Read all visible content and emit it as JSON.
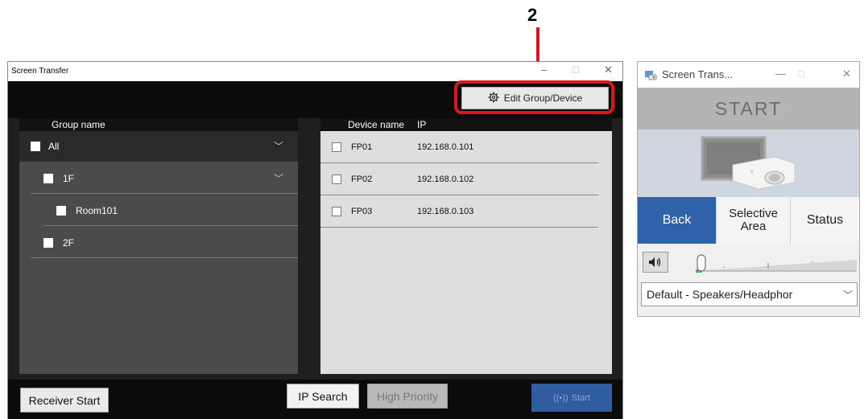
{
  "callout": {
    "number": "2"
  },
  "main_window": {
    "title": "Screen Transfer",
    "controls": {
      "minimize": "–",
      "maximize": "□",
      "close": "✕"
    },
    "edit_button": {
      "label": "Edit Group/Device",
      "icon": "gear-icon"
    },
    "group_panel": {
      "header": "Group name",
      "rows": [
        {
          "label": "All",
          "checked": false,
          "expandable": true
        },
        {
          "label": "1F",
          "checked": false,
          "expandable": true
        },
        {
          "label": "Room101",
          "checked": false,
          "expandable": false
        },
        {
          "label": "2F",
          "checked": false,
          "expandable": false
        }
      ]
    },
    "device_panel": {
      "header_name": "Device name",
      "header_ip": "IP",
      "rows": [
        {
          "name": "FP01",
          "ip": "192.168.0.101"
        },
        {
          "name": "FP02",
          "ip": "192.168.0.102"
        },
        {
          "name": "FP03",
          "ip": "192.168.0.103"
        }
      ]
    },
    "buttons": {
      "receiver_start": "Receiver Start",
      "ip_search": "IP Search",
      "high_priority": "High Priority",
      "start": "Start"
    }
  },
  "mini_window": {
    "title": "Screen Trans...",
    "controls": {
      "minimize": "—",
      "maximize": "□",
      "close": "✕"
    },
    "start_label": "START",
    "buttons": {
      "back": "Back",
      "selective_area": "Selective Area",
      "status": "Status"
    },
    "audio_device": "Default - Speakers/Headphor",
    "colors": {
      "back_active": "#2f62a8"
    }
  }
}
